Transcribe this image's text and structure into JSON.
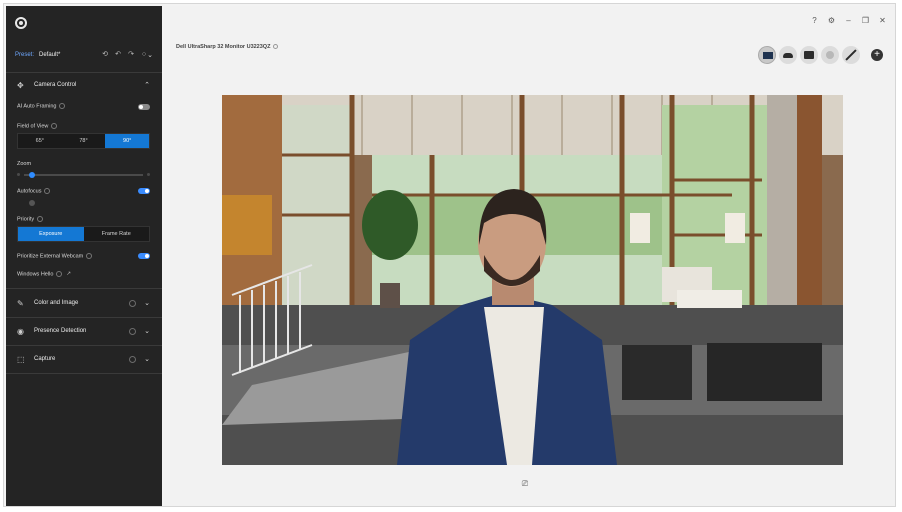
{
  "sidebar": {
    "preset": {
      "label": "Preset:",
      "value": "Default*"
    },
    "camera_control": {
      "title": "Camera Control",
      "ai_auto_framing": {
        "label": "AI Auto Framing",
        "enabled": false
      },
      "field_of_view": {
        "label": "Field of View",
        "options": [
          "65°",
          "78°",
          "90°"
        ],
        "selected": "90°"
      },
      "zoom": {
        "label": "Zoom",
        "level": 0
      },
      "autofocus": {
        "label": "Autofocus",
        "enabled": true
      },
      "priority": {
        "label": "Priority",
        "options": [
          "Exposure",
          "Frame Rate"
        ],
        "selected": "Exposure"
      },
      "prioritize_external": {
        "label": "Prioritize External Webcam",
        "enabled": true
      },
      "windows_hello": {
        "label": "Windows Hello"
      }
    },
    "sections": [
      {
        "title": "Color and Image",
        "icon": "color-image-icon"
      },
      {
        "title": "Presence Detection",
        "icon": "presence-icon"
      },
      {
        "title": "Capture",
        "icon": "capture-icon"
      }
    ]
  },
  "main": {
    "device_name": "Dell UltraSharp 32 Monitor U3223QZ",
    "window_controls": [
      "help-icon",
      "settings-icon",
      "minimize-icon",
      "restore-icon",
      "close-icon"
    ],
    "devices": [
      "monitor-icon",
      "mouse-icon",
      "webcam-icon",
      "headset-icon",
      "pen-icon"
    ]
  },
  "colors": {
    "sidebar_bg": "#242424",
    "accent": "#1478d4",
    "preset_label": "#6ea8ff",
    "main_bg": "#f2f2f2"
  }
}
